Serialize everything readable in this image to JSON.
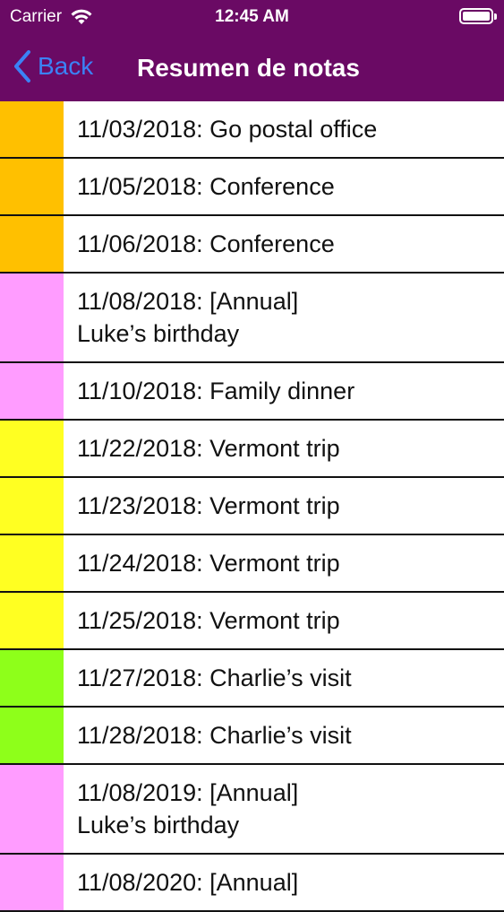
{
  "status_bar": {
    "carrier": "Carrier",
    "time": "12:45 AM"
  },
  "nav": {
    "back_label": "Back",
    "title": "Resumen de notas"
  },
  "colors": {
    "header_bg": "#6a0a64",
    "back_tint": "#3b82f6",
    "orange": "#ffc000",
    "pink": "#ff9cff",
    "yellow": "#ffff22",
    "green": "#8eff1a"
  },
  "notes": [
    {
      "text": "11/03/2018: Go postal office",
      "color": "#ffc000"
    },
    {
      "text": "11/05/2018: Conference",
      "color": "#ffc000"
    },
    {
      "text": "11/06/2018: Conference",
      "color": "#ffc000"
    },
    {
      "text": "11/08/2018: [Annual]\nLuke’s birthday",
      "color": "#ff9cff"
    },
    {
      "text": "11/10/2018: Family dinner",
      "color": "#ff9cff"
    },
    {
      "text": "11/22/2018: Vermont trip",
      "color": "#ffff22"
    },
    {
      "text": "11/23/2018: Vermont trip",
      "color": "#ffff22"
    },
    {
      "text": "11/24/2018: Vermont trip",
      "color": "#ffff22"
    },
    {
      "text": "11/25/2018: Vermont trip",
      "color": "#ffff22"
    },
    {
      "text": "11/27/2018: Charlie’s visit",
      "color": "#8eff1a"
    },
    {
      "text": "11/28/2018: Charlie’s visit",
      "color": "#8eff1a"
    },
    {
      "text": "11/08/2019: [Annual]\nLuke’s birthday",
      "color": "#ff9cff"
    },
    {
      "text": "11/08/2020: [Annual]",
      "color": "#ff9cff"
    }
  ]
}
